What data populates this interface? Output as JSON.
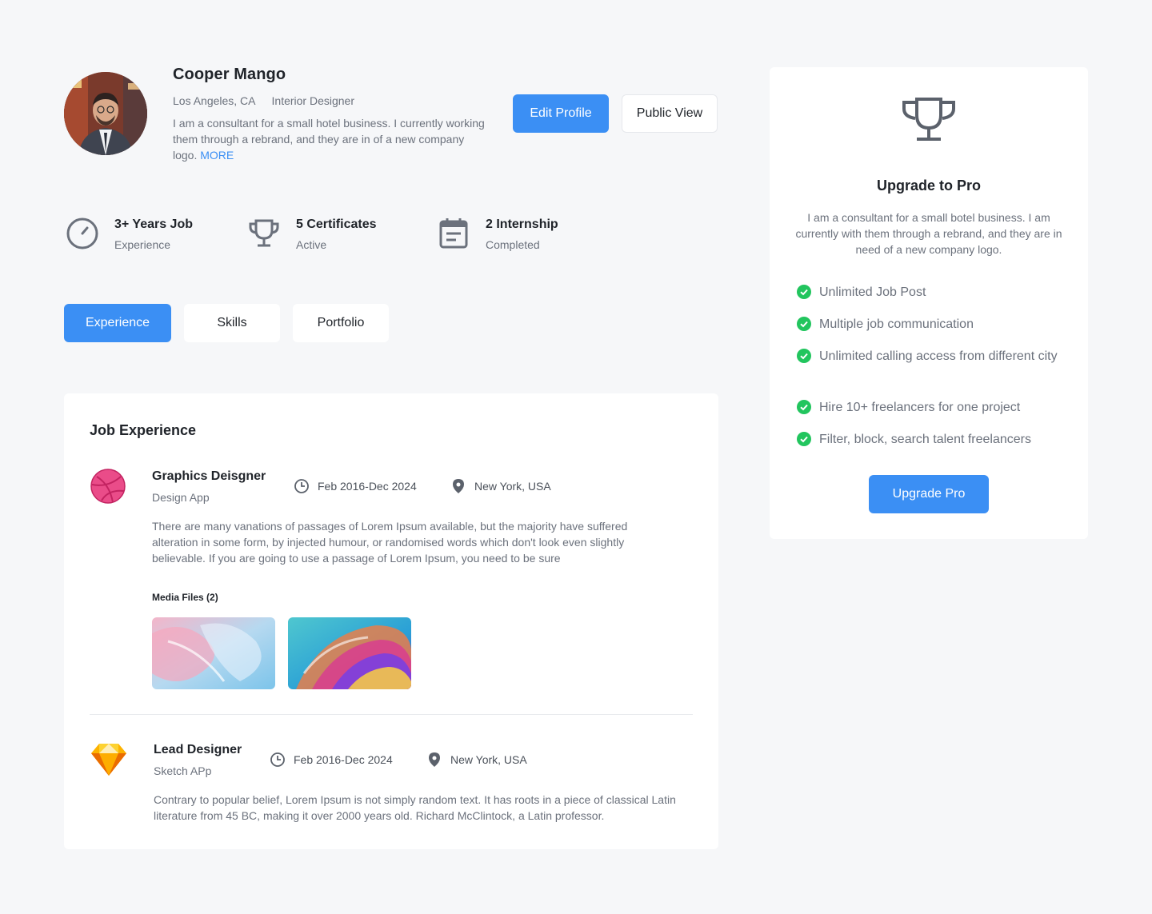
{
  "profile": {
    "name": "Cooper Mango",
    "location": "Los Angeles, CA",
    "role": "Interior Designer",
    "bio": "I am a consultant for a small hotel business. I currently working them through a rebrand, and they are in of a new company logo.",
    "more_label": "MORE",
    "edit_label": "Edit Profile",
    "public_label": "Public View"
  },
  "stats": [
    {
      "title": "3+ Years Job",
      "sub": "Experience",
      "icon": "speedometer-icon"
    },
    {
      "title": "5 Certificates",
      "sub": "Active",
      "icon": "trophy-icon"
    },
    {
      "title": "2 Internship",
      "sub": "Completed",
      "icon": "calendar-icon"
    }
  ],
  "tabs": [
    {
      "label": "Experience",
      "active": true
    },
    {
      "label": "Skills",
      "active": false
    },
    {
      "label": "Portfolio",
      "active": false
    }
  ],
  "experience": {
    "title": "Job Experience",
    "media_label": "Media Files (2)",
    "jobs": [
      {
        "title": "Graphics Deisgner",
        "company": "Design App",
        "dates": "Feb 2016-Dec 2024",
        "location": "New York, USA",
        "description": "There are many vanations of passages of Lorem Ipsum available, but the majority have suffered alteration in some form, by injected humour, or randomised words which don't look even slightly believable. If you are going to use a passage of Lorem Ipsum, you need to be sure",
        "logo": "dribbble-icon"
      },
      {
        "title": "Lead Designer",
        "company": "Sketch APp",
        "dates": "Feb 2016-Dec 2024",
        "location": "New York, USA",
        "description": "Contrary to popular belief, Lorem Ipsum is not simply random text. It has roots in a piece of classical Latin literature from 45 BC, making it over 2000 years old. Richard McClintock, a Latin professor.",
        "logo": "sketch-icon"
      }
    ]
  },
  "pro": {
    "title": "Upgrade to Pro",
    "description": "I am a consultant for a small botel business. I am currently with them through a rebrand, and they are in need of a new company logo.",
    "features": [
      "Unlimited Job Post",
      "Multiple job communication",
      "Unlimited calling access from different city",
      "Hire 10+ freelancers for one project",
      "Filter, block, search talent freelancers"
    ],
    "button_label": "Upgrade Pro"
  },
  "colors": {
    "accent": "#3b8ff4",
    "check": "#22c55e",
    "dribbble": "#ea4c89",
    "sketch": "#fdb300"
  }
}
